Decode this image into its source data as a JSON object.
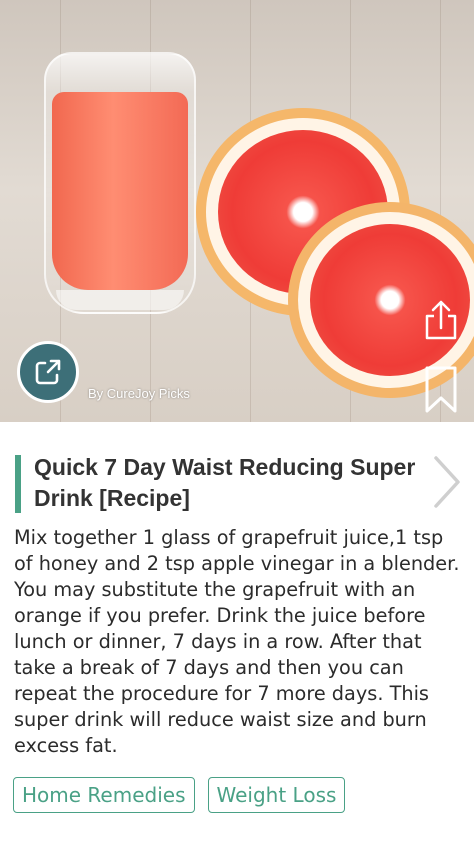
{
  "hero": {
    "credit": "By CureJoy Picks",
    "icons": [
      "external-link-icon",
      "share-icon",
      "bookmark-icon"
    ]
  },
  "article": {
    "title": "Quick 7 Day Waist Reducing Super Drink [Recipe]",
    "body": "Mix together 1 glass of grapefruit juice,1 tsp of honey and 2 tsp apple vinegar in a blender. You may substitute the grapefruit with an orange if you prefer. Drink the juice before lunch or dinner, 7 days in a row. After that take a break of 7 days and then you can repeat the procedure for 7 more days. This super drink will reduce waist size and burn excess fat.",
    "next_icon": "chevron-right-icon"
  },
  "tags": [
    {
      "label": "Home Remedies"
    },
    {
      "label": "Weight Loss"
    }
  ],
  "colors": {
    "accent": "#4aa186",
    "source_button": "#3d6f78",
    "text": "#2b2b2b"
  }
}
